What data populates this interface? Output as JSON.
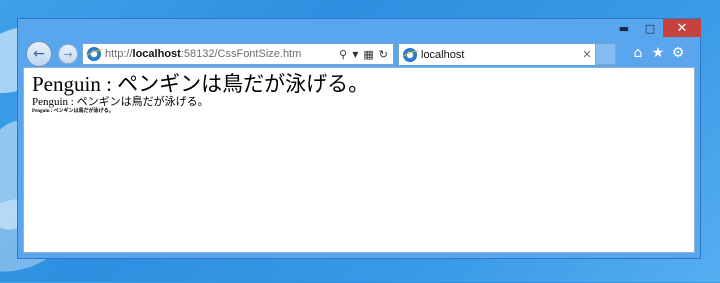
{
  "browser": {
    "address_url_prefix": "http://",
    "address_url_host": "localhost",
    "address_url_rest": ":58132/CssFontSize.htm",
    "tab_title": "localhost"
  },
  "content": {
    "lines": [
      "Penguin : ペンギンは鳥だが泳げる。",
      "Penguin : ペンギンは鳥だが泳げる。",
      "Penguin : ペンギンは鳥だが泳げる。"
    ]
  },
  "icons": {
    "back": "arrow-left-icon",
    "forward": "arrow-right-icon",
    "site": "ie-logo-icon",
    "search": "search-icon",
    "dropdown": "chevron-down-icon",
    "compat": "compatibility-view-icon",
    "refresh": "refresh-icon",
    "close_tab": "close-icon",
    "home": "home-icon",
    "favorites": "star-icon",
    "tools": "gear-icon"
  },
  "colors": {
    "desktop": "#3a9ae6",
    "window_frame": "#5aa6ee",
    "close_button": "#c7413d"
  }
}
